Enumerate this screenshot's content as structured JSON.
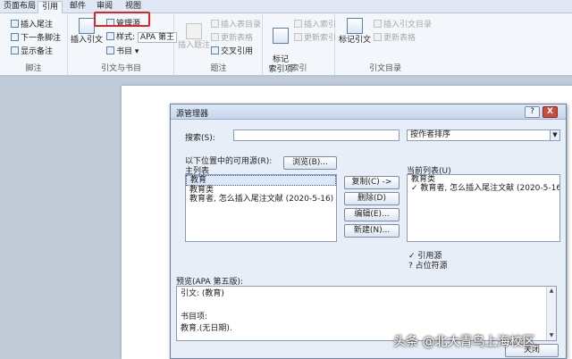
{
  "ribbon": {
    "tabs": [
      {
        "label": "页面布局"
      },
      {
        "label": "引用"
      },
      {
        "label": "邮件"
      },
      {
        "label": "审阅"
      },
      {
        "label": "视图"
      }
    ],
    "footnotes": {
      "insert_endnote": "插入尾注",
      "next_footnote": "下一条脚注",
      "show_notes": "显示备注",
      "group_label": "脚注"
    },
    "citations": {
      "insert_citation": "插入引文",
      "manage_sources": "管理源",
      "style_label": "样式:",
      "style_value": "APA 第王",
      "bibliography": "书目",
      "group_label": "引文与书目"
    },
    "captions": {
      "insert_caption": "插入题注",
      "insert_table_of_figures": "插入表目录",
      "update_table": "更新表格",
      "cross_reference": "交叉引用",
      "group_label": "题注"
    },
    "index": {
      "mark_entry": "标记\n索引项",
      "insert_index": "插入索引",
      "update_index": "更新索引",
      "group_label": "索引"
    },
    "toa": {
      "mark_citation": "标记引文",
      "insert_toa": "插入引文目录",
      "update_table": "更新表格",
      "group_label": "引文目录"
    }
  },
  "dialog": {
    "title": "源管理器",
    "help": "?",
    "close": "X",
    "search_label": "搜索(S):",
    "search_value": "",
    "sort_value": "按作者排序",
    "available_label": "以下位置中的可用源(R):",
    "master_list_label": "主列表",
    "browse_button": "浏览(B)...",
    "master_list": [
      "教育",
      "教育类",
      "教育者, 怎么插入尾注文献 (2020-5-16)"
    ],
    "copy_button": "复制(C) ->",
    "delete_button": "删除(D)",
    "edit_button": "编辑(E)...",
    "new_button": "新建(N)...",
    "current_list_label": "当前列表(U)",
    "current_list": [
      "教育类",
      "✓ 教育者, 怎么插入尾注文献 (2020-5-16)"
    ],
    "legend_cited": "✓ 引用源",
    "legend_placeholder": "? 占位符源",
    "preview_label": "预览(APA 第五版):",
    "preview_lines": [
      "引文: (教育)",
      "",
      "书目项:",
      "教育.(无日期)."
    ],
    "close_button": "关闭"
  },
  "watermark": "头条 @北大青鸟上海校区"
}
